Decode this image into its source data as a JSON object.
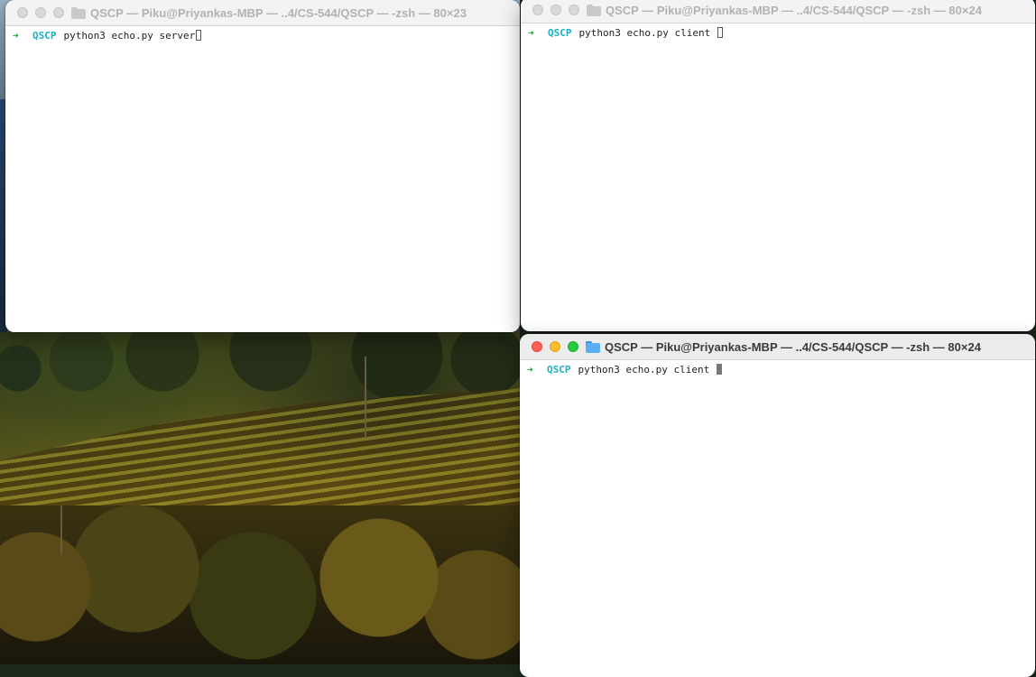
{
  "windows": [
    {
      "title": "QSCP — Piku@Priyankas-MBP — ..4/CS-544/QSCP — -zsh — 80×23",
      "prompt_arrow": "➜",
      "prompt_dir": "QSCP",
      "command": "python3 echo.py server"
    },
    {
      "title": "QSCP — Piku@Priyankas-MBP — ..4/CS-544/QSCP — -zsh — 80×24",
      "prompt_arrow": "➜",
      "prompt_dir": "QSCP",
      "command": "python3 echo.py client "
    },
    {
      "title": "QSCP — Piku@Priyankas-MBP — ..4/CS-544/QSCP — -zsh — 80×24",
      "prompt_arrow": "➜",
      "prompt_dir": "QSCP",
      "command": "python3 echo.py client "
    }
  ],
  "colors": {
    "prompt_arrow": "#1aa32c",
    "prompt_dir": "#1ab0c4",
    "close": "#ff5f57",
    "minimize": "#febc2e",
    "zoom": "#28c840"
  },
  "icons": [
    "folder-icon",
    "close-button",
    "minimize-button",
    "zoom-button"
  ]
}
